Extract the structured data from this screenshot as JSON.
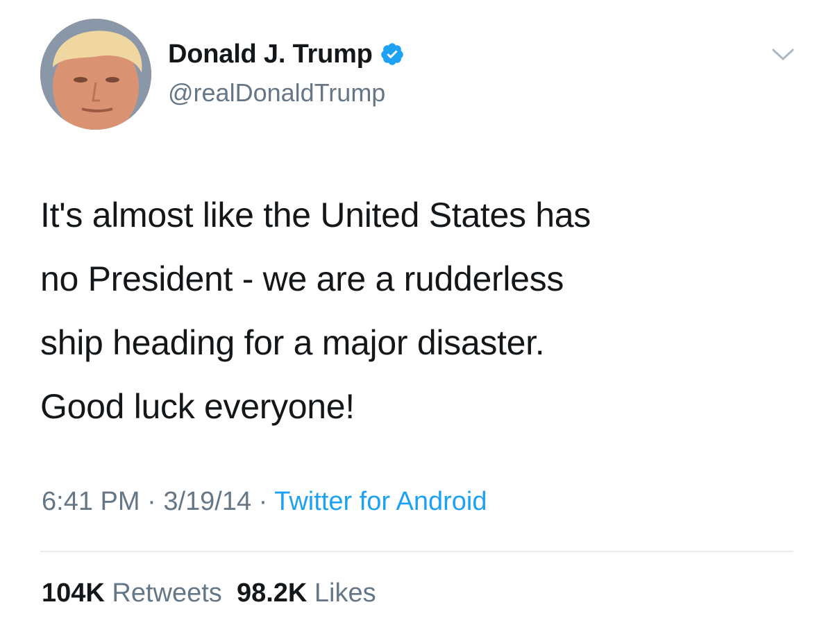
{
  "user": {
    "display_name": "Donald J. Trump",
    "handle": "@realDonaldTrump",
    "verified_icon": "verified-badge-icon",
    "avatar_icon": "profile-photo"
  },
  "tweet": {
    "text": "It's almost like the United States has\nno President - we are a rudderless\nship heading for a major disaster.\nGood luck everyone!"
  },
  "meta": {
    "time": "6:41 PM",
    "separator": " · ",
    "date": "3/19/14",
    "source": "Twitter for Android"
  },
  "stats": {
    "retweets_count": "104K",
    "retweets_label": "Retweets",
    "likes_count": "98.2K",
    "likes_label": "Likes"
  },
  "colors": {
    "text_primary": "#14171a",
    "text_secondary": "#657786",
    "link_blue": "#1da1f2",
    "divider": "#e6ecf0"
  },
  "icons": {
    "menu": "chevron-down-icon"
  }
}
